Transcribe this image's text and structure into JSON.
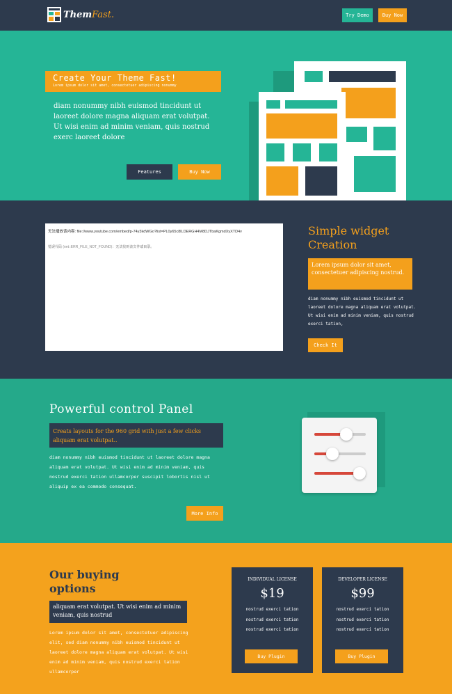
{
  "nav": {
    "brand_bold": "Them",
    "brand_italic": "Fast.",
    "try_demo": "Try Demo",
    "buy_now": "Buy Now"
  },
  "hero": {
    "title": "Create Your Theme Fast!",
    "subtitle": "Lorem ipsum dolor sit amet, consectetuer adipiscing nonummy",
    "text": "diam nonummy nibh euismod tincidunt ut laoreet dolore magna aliquam erat volutpat. Ut wisi enim ad minim veniam, quis nostrud exerc laoreet dolore",
    "features_button": "Features",
    "buy_button": "Buy Now"
  },
  "widget": {
    "video_error_line1": "无法播放该内容: file://www.youtube.com/embed/p-74y3kdWGo?list=PL0y65c8lLDERGH4M8DJTbaKgmdXyXTD4v",
    "video_error_line2": "错误代码 (net::ERR_FILE_NOT_FOUND)：无法找到该文件或目录。",
    "title": "Simple widget Creation",
    "box": "Lorem ipsum dolor sit amet, consectetuer adipiscing nostrud.",
    "text": "diam nonummy nibh euismod tincidunt ut laoreet dolore magna aliquam erat volutpat. Ut wisi enim ad minim veniam, quis nostrud exerci tation,",
    "button": "Check It"
  },
  "panel": {
    "title": "Powerful control Panel",
    "box": "Creats layouts for the 960 grid with just a few clicks aliquam erat volutpat..",
    "text": "diam nonummy nibh euismod tincidunt ut laoreet dolore magna aliquam erat volutpat. Ut wisi enim ad minim veniam, quis nostrud exerci tation ullamcorper suscipit lobortis nisl ut aliquip ex ea commodo consequat.",
    "button": "More Info",
    "slider_levels": [
      0.62,
      0.35,
      0.88
    ],
    "colors": {
      "slider_active": "#d6473a",
      "slider_track": "#cccccc"
    }
  },
  "buying": {
    "title_line1": "Our buying",
    "title_line2": "options",
    "box": "aliquam erat volutpat. Ut wisi enim ad minim veniam, quis nostrud",
    "text": "Lorem ipsum dolor sit amet, consectetuer adipiscing elit, sed diam nonummy nibh euismod tincidunt ut laoreet dolore magna aliquam erat volutpat. Ut wisi enim ad minim veniam, quis nostrud exerci tation ullamcorper",
    "cards": [
      {
        "heading": "INDIVIDUAL LICENSE",
        "price": "$19",
        "features": [
          "nostrud exerci tation",
          "nostrud exerci tation",
          "nostrud exerci tation"
        ],
        "button": "Buy Plugin"
      },
      {
        "heading": "DEVELOPER LICENSE",
        "price": "$99",
        "features": [
          "nostrud exerci tation",
          "nostrud exerci tation",
          "nostrud exerci tation"
        ],
        "button": "Buy Plugin"
      }
    ]
  },
  "colors": {
    "navy": "#2d3a4d",
    "teal": "#25b596",
    "orange": "#f4a01c"
  }
}
